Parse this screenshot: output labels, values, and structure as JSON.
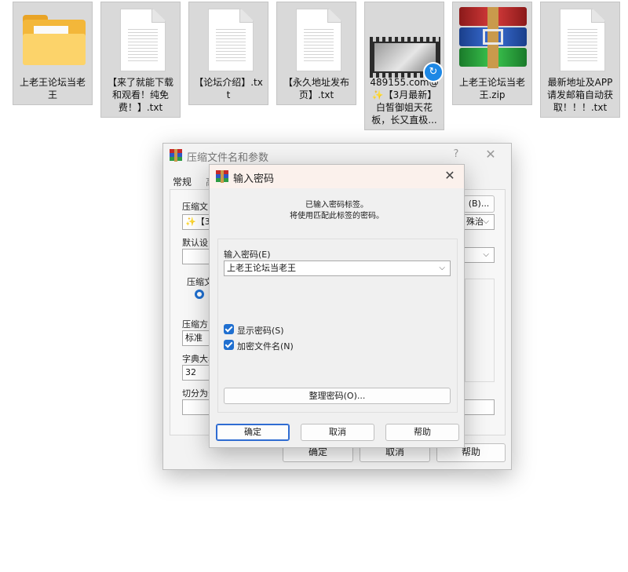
{
  "desktop": {
    "files": [
      {
        "label": "上老王论坛当老王",
        "type": "folder"
      },
      {
        "label": "【来了就能下载和观看！纯免费！】.txt",
        "type": "text-document"
      },
      {
        "label": "【论坛介绍】.txt",
        "type": "text-document"
      },
      {
        "label": "【永久地址发布页】.txt",
        "type": "text-document"
      },
      {
        "label": "489155.com@✨【3月最新】白皙御姐天花板，长又直极...",
        "type": "video"
      },
      {
        "label": "上老王论坛当老王.zip",
        "type": "winrar-archive"
      },
      {
        "label": "最新地址及APP请发邮箱自动获取！！！.txt",
        "type": "text-document"
      }
    ]
  },
  "archive_dialog": {
    "title": "压缩文件名和参数",
    "help_button": "?",
    "close_button": "✕",
    "tab_general": "常规",
    "tab_advanced_partial": "高",
    "archive_name_label_partial": "压缩文",
    "archive_name_value_partial": "✨【3月",
    "browse_button_partial": "(B)...",
    "update_mode_partial": "殊治",
    "default_settings_label_partial": "默认设",
    "format_group_label_partial": "压缩文",
    "method_label_partial": "压缩方",
    "method_value": "标准",
    "dict_label_partial": "字典大小",
    "dict_value": "32",
    "split_label_partial": "切分为分",
    "ok_button": "确定",
    "cancel_button": "取消",
    "help_bottom_button": "帮助"
  },
  "password_dialog": {
    "title": "输入密码",
    "close_button": "✕",
    "info_line1": "已输入密码标签。",
    "info_line2": "将使用匹配此标签的密码。",
    "password_label": "输入密码(E)",
    "password_value": "上老王论坛当老王",
    "show_password_label": "显示密码(S)",
    "show_password_checked": true,
    "encrypt_names_label": "加密文件名(N)",
    "encrypt_names_checked": true,
    "organize_button": "整理密码(O)...",
    "ok_button": "确定",
    "cancel_button": "取消",
    "help_button": "帮助"
  },
  "colors": {
    "accent": "#1f6fd0",
    "dialog_bg": "#f3f3f3",
    "password_title_bg": "#fbf1ec"
  }
}
